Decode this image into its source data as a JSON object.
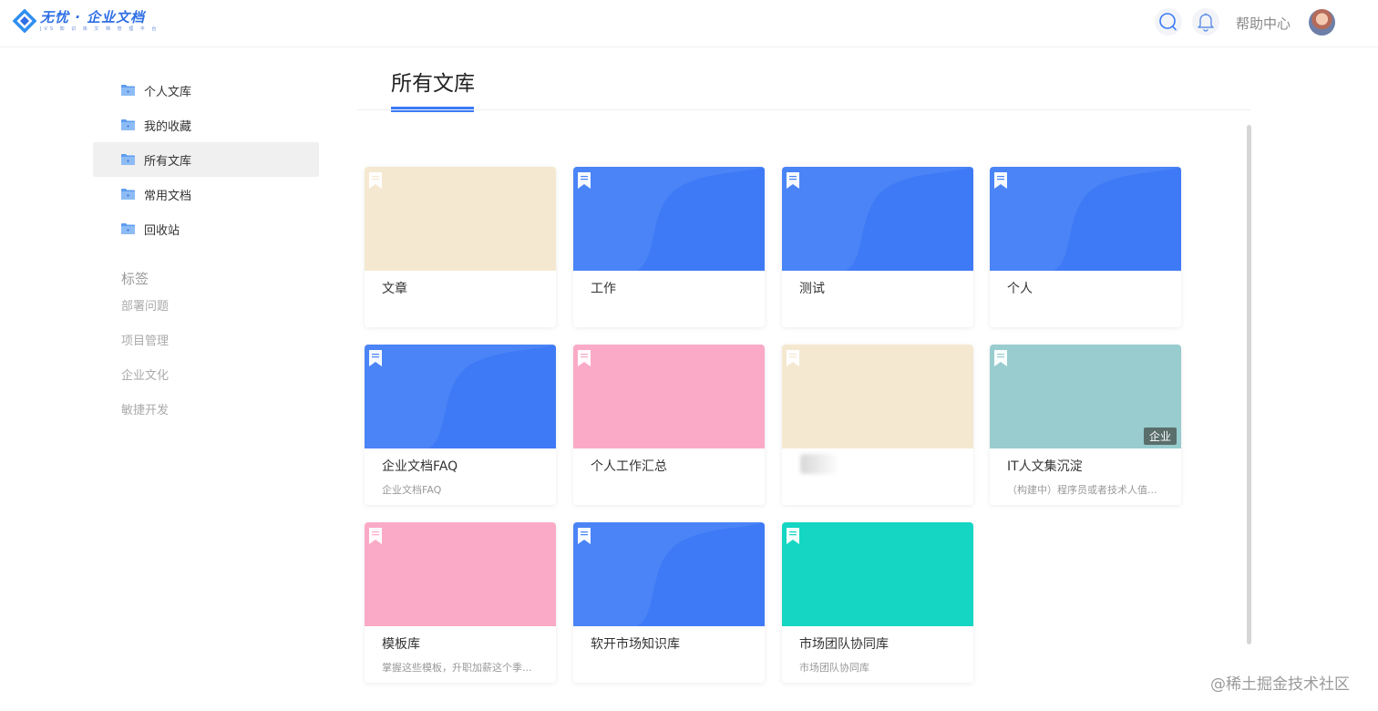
{
  "header": {
    "logo_title": "无忧 · 企业文档",
    "logo_subtitle": "JVS 知 识 库 文 档 管 理 平 台",
    "help_label": "帮助中心",
    "icons": [
      "search-icon",
      "bell-icon",
      "avatar"
    ]
  },
  "sidebar": {
    "items": [
      {
        "label": "个人文库",
        "icon": "folder-icon"
      },
      {
        "label": "我的收藏",
        "icon": "folder-icon"
      },
      {
        "label": "所有文库",
        "icon": "folder-icon",
        "active": true
      },
      {
        "label": "常用文档",
        "icon": "folder-icon"
      },
      {
        "label": "回收站",
        "icon": "folder-icon"
      }
    ],
    "tags_title": "标签",
    "tags": [
      "部署问题",
      "项目管理",
      "企业文化",
      "敏捷开发"
    ]
  },
  "main": {
    "title": "所有文库",
    "cards": [
      {
        "name": "文章",
        "desc": "",
        "cover": "beige"
      },
      {
        "name": "工作",
        "desc": "",
        "cover": "blue"
      },
      {
        "name": "测试",
        "desc": "",
        "cover": "blue"
      },
      {
        "name": "个人",
        "desc": "",
        "cover": "blue"
      },
      {
        "name": "企业文档FAQ",
        "desc": "企业文档FAQ",
        "cover": "blue"
      },
      {
        "name": "个人工作汇总",
        "desc": "",
        "cover": "pink"
      },
      {
        "name": "",
        "desc": "",
        "cover": "beige",
        "name_blurred": true
      },
      {
        "name": "IT人文集沉淀",
        "desc": "（构建中）程序员或者技术人值...",
        "cover": "teal-gray",
        "badge": "企业"
      },
      {
        "name": "模板库",
        "desc": "掌握这些模板，升职加薪这个季...",
        "cover": "pink"
      },
      {
        "name": "软开市场知识库",
        "desc": "",
        "cover": "blue"
      },
      {
        "name": "市场团队协同库",
        "desc": "市场团队协同库",
        "cover": "green"
      }
    ]
  },
  "watermark": "@稀土掘金技术社区",
  "colors": {
    "accent": "#3b7af7",
    "blue": "#4a84f6",
    "beige": "#f5e8d1",
    "pink": "#faaac7",
    "teal-gray": "#98ccce",
    "green": "#14d6c3"
  }
}
